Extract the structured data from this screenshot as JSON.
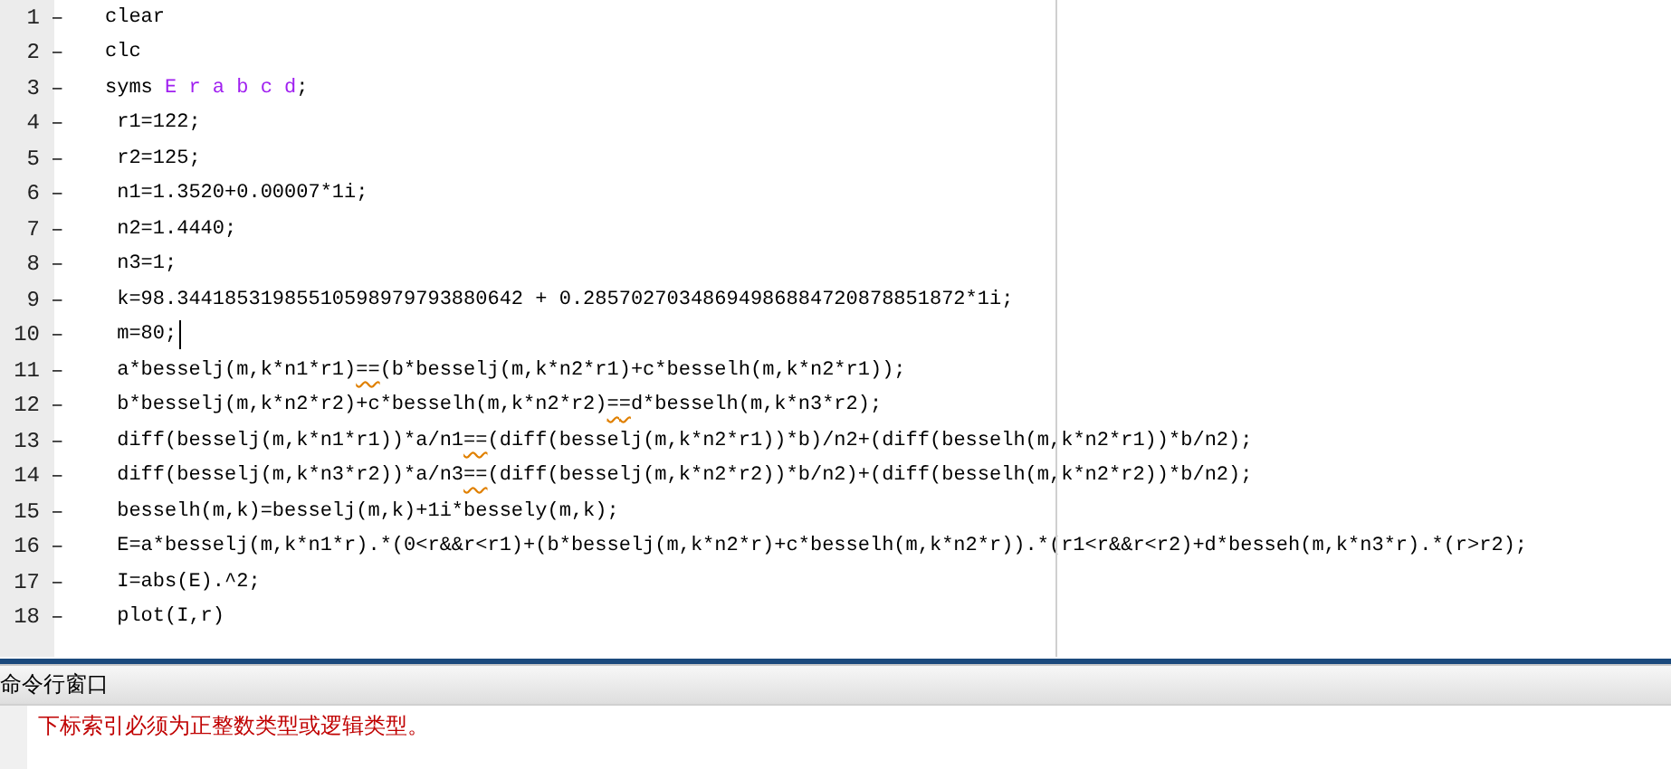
{
  "editor": {
    "lines": [
      {
        "number": "1",
        "marker": "–",
        "has_cursor": false,
        "segments": [
          {
            "kind": "plain",
            "text": "clear"
          }
        ]
      },
      {
        "number": "2",
        "marker": "–",
        "has_cursor": false,
        "segments": [
          {
            "kind": "plain",
            "text": "clc"
          }
        ]
      },
      {
        "number": "3",
        "marker": "–",
        "has_cursor": false,
        "segments": [
          {
            "kind": "plain",
            "text": "syms "
          },
          {
            "kind": "symbol",
            "text": "E r a b c d"
          },
          {
            "kind": "plain",
            "text": ";"
          }
        ]
      },
      {
        "number": "4",
        "marker": "–",
        "has_cursor": false,
        "segments": [
          {
            "kind": "plain",
            "text": " r1=122;"
          }
        ]
      },
      {
        "number": "5",
        "marker": "–",
        "has_cursor": false,
        "segments": [
          {
            "kind": "plain",
            "text": " r2=125;"
          }
        ]
      },
      {
        "number": "6",
        "marker": "–",
        "has_cursor": false,
        "segments": [
          {
            "kind": "plain",
            "text": " n1=1.3520+0.00007*1i;"
          }
        ]
      },
      {
        "number": "7",
        "marker": "–",
        "has_cursor": false,
        "segments": [
          {
            "kind": "plain",
            "text": " n2=1.4440;"
          }
        ]
      },
      {
        "number": "8",
        "marker": "–",
        "has_cursor": false,
        "segments": [
          {
            "kind": "plain",
            "text": " n3=1;"
          }
        ]
      },
      {
        "number": "9",
        "marker": "–",
        "has_cursor": false,
        "segments": [
          {
            "kind": "plain",
            "text": " k=98.34418531985510598979793880642 + 0.28570270348694986884720878851872*1i;"
          }
        ]
      },
      {
        "number": "10",
        "marker": "–",
        "has_cursor": true,
        "segments": [
          {
            "kind": "plain",
            "text": " m=80;"
          }
        ]
      },
      {
        "number": "11",
        "marker": "–",
        "has_cursor": false,
        "segments": [
          {
            "kind": "plain",
            "text": " a*besselj(m,k*n1*r1)"
          },
          {
            "kind": "warning",
            "text": "=="
          },
          {
            "kind": "plain",
            "text": "(b*besselj(m,k*n2*r1)+c*besselh(m,k*n2*r1));"
          }
        ]
      },
      {
        "number": "12",
        "marker": "–",
        "has_cursor": false,
        "segments": [
          {
            "kind": "plain",
            "text": " b*besselj(m,k*n2*r2)+c*besselh(m,k*n2*r2)"
          },
          {
            "kind": "warning",
            "text": "=="
          },
          {
            "kind": "plain",
            "text": "d*besselh(m,k*n3*r2);"
          }
        ]
      },
      {
        "number": "13",
        "marker": "–",
        "has_cursor": false,
        "segments": [
          {
            "kind": "plain",
            "text": " diff(besselj(m,k*n1*r1))*a/n1"
          },
          {
            "kind": "warning",
            "text": "=="
          },
          {
            "kind": "plain",
            "text": "(diff(besselj(m,k*n2*r1))*b)/n2+(diff(besselh(m,k*n2*r1))*b/n2);"
          }
        ]
      },
      {
        "number": "14",
        "marker": "–",
        "has_cursor": false,
        "segments": [
          {
            "kind": "plain",
            "text": " diff(besselj(m,k*n3*r2))*a/n3"
          },
          {
            "kind": "warning",
            "text": "=="
          },
          {
            "kind": "plain",
            "text": "(diff(besselj(m,k*n2*r2))*b/n2)+(diff(besselh(m,k*n2*r2))*b/n2);"
          }
        ]
      },
      {
        "number": "15",
        "marker": "–",
        "has_cursor": false,
        "segments": [
          {
            "kind": "plain",
            "text": " besselh(m,k)=besselj(m,k)+1i*bessely(m,k);"
          }
        ]
      },
      {
        "number": "16",
        "marker": "–",
        "has_cursor": false,
        "segments": [
          {
            "kind": "plain",
            "text": " E=a*besselj(m,k*n1*r).*(0<r&&r<r1)+(b*besselj(m,k*n2*r)+c*besselh(m,k*n2*r)).*(r1<r&&r<r2)+d*besseh(m,k*n3*r).*(r>r2);"
          }
        ]
      },
      {
        "number": "17",
        "marker": "–",
        "has_cursor": false,
        "segments": [
          {
            "kind": "plain",
            "text": " I=abs(E).^2;"
          }
        ]
      },
      {
        "number": "18",
        "marker": "–",
        "has_cursor": false,
        "segments": [
          {
            "kind": "plain",
            "text": " plot(I,r)"
          }
        ]
      }
    ]
  },
  "command_window": {
    "title": "命令行窗口",
    "messages": [
      {
        "kind": "error",
        "text": "下标索引必须为正整数类型或逻辑类型。"
      }
    ]
  }
}
